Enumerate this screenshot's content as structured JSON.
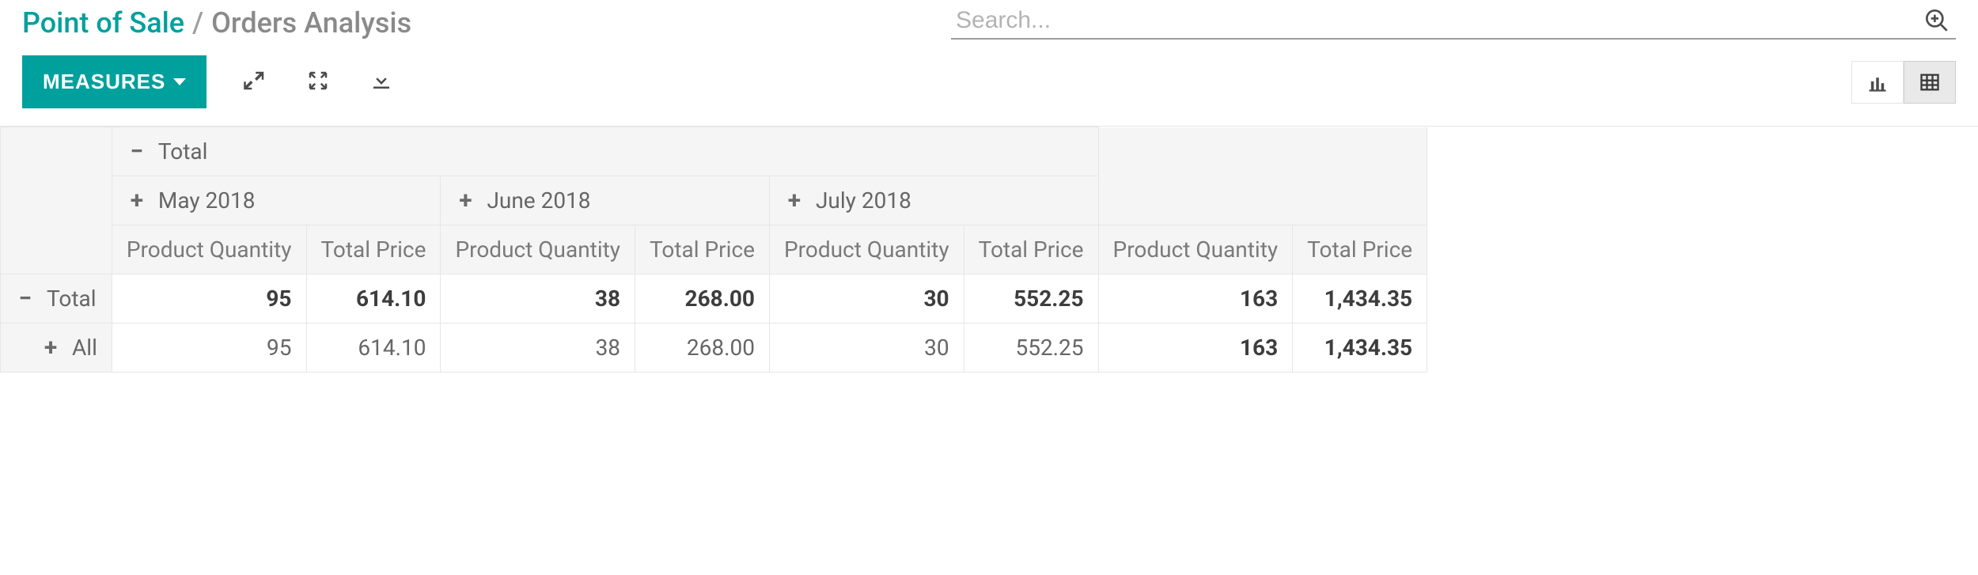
{
  "breadcrumb": {
    "first": "Point of Sale",
    "sep": "/",
    "second": "Orders Analysis"
  },
  "search": {
    "placeholder": "Search..."
  },
  "toolbar": {
    "measures_label": "MEASURES"
  },
  "pivot": {
    "col_root": "Total",
    "col_groups": [
      "May 2018",
      "June 2018",
      "July 2018"
    ],
    "measures": [
      "Product Quantity",
      "Total Price"
    ],
    "rows": [
      {
        "label": "Total",
        "expand": "minus",
        "bold_group": true,
        "cells": [
          "95",
          "614.10",
          "38",
          "268.00",
          "30",
          "552.25",
          "163",
          "1,434.35"
        ]
      },
      {
        "label": "All",
        "expand": "plus",
        "child": true,
        "cells": [
          "95",
          "614.10",
          "38",
          "268.00",
          "30",
          "552.25",
          "163",
          "1,434.35"
        ]
      }
    ]
  },
  "chart_data": {
    "type": "table",
    "title": "Orders Analysis",
    "columns": [
      "May 2018",
      "June 2018",
      "July 2018",
      "Total"
    ],
    "measures": [
      "Product Quantity",
      "Total Price"
    ],
    "series": [
      {
        "name": "Product Quantity",
        "values": [
          95,
          38,
          30,
          163
        ]
      },
      {
        "name": "Total Price",
        "values": [
          614.1,
          268.0,
          552.25,
          1434.35
        ]
      }
    ],
    "rows": [
      {
        "name": "Total",
        "Product Quantity": [
          95,
          38,
          30,
          163
        ],
        "Total Price": [
          614.1,
          268.0,
          552.25,
          1434.35
        ]
      },
      {
        "name": "All",
        "Product Quantity": [
          95,
          38,
          30,
          163
        ],
        "Total Price": [
          614.1,
          268.0,
          552.25,
          1434.35
        ]
      }
    ]
  }
}
